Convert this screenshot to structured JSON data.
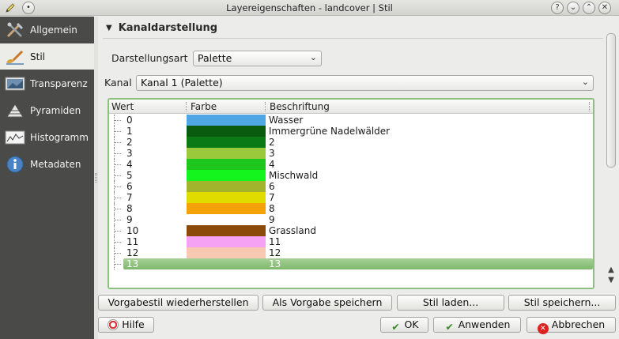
{
  "window": {
    "title": "Layereigenschaften - landcover | Stil",
    "title_icons": [
      "pencil-icon",
      "menu-icon"
    ],
    "controls": {
      "help": "?",
      "minimize": "⌄",
      "maximize": "⌃",
      "close": "✕"
    }
  },
  "sidebar": {
    "items": [
      {
        "label": "Allgemein",
        "icon": "tools-icon",
        "active": false
      },
      {
        "label": "Stil",
        "icon": "brush-icon",
        "active": true
      },
      {
        "label": "Transparenz",
        "icon": "transparency-icon",
        "active": false
      },
      {
        "label": "Pyramiden",
        "icon": "pyramid-icon",
        "active": false
      },
      {
        "label": "Histogramm",
        "icon": "histogram-icon",
        "active": false
      },
      {
        "label": "Metadaten",
        "icon": "info-icon",
        "active": false
      }
    ]
  },
  "section": {
    "title": "Kanaldarstellung",
    "arrow": "▼"
  },
  "render_type": {
    "label": "Darstellungsart",
    "value": "Palette"
  },
  "band": {
    "label": "Kanal",
    "value": "Kanal 1 (Palette)"
  },
  "table": {
    "headers": {
      "wert": "Wert",
      "farbe": "Farbe",
      "beschriftung": "Beschriftung"
    },
    "rows": [
      {
        "wert": "0",
        "color": "#4fa6e2",
        "label": "Wasser"
      },
      {
        "wert": "1",
        "color": "#0a5a10",
        "label": "Immergrüne Nadelwälder"
      },
      {
        "wert": "2",
        "color": "#0b7a16",
        "label": "2"
      },
      {
        "wert": "3",
        "color": "#9ac93c",
        "label": "3"
      },
      {
        "wert": "4",
        "color": "#1ec71e",
        "label": "4"
      },
      {
        "wert": "5",
        "color": "#14f51e",
        "label": "Mischwald"
      },
      {
        "wert": "6",
        "color": "#a2b42c",
        "label": "6"
      },
      {
        "wert": "7",
        "color": "#e0dc00",
        "label": "7"
      },
      {
        "wert": "8",
        "color": "#f5a10a",
        "label": "8"
      },
      {
        "wert": "9",
        "color": "#ffffff",
        "label": "9"
      },
      {
        "wert": "10",
        "color": "#8c4a0a",
        "label": "Grassland"
      },
      {
        "wert": "11",
        "color": "#f5a2f5",
        "label": "11"
      },
      {
        "wert": "12",
        "color": "#f8c9b0",
        "label": "12"
      },
      {
        "wert": "13",
        "color": "#8fc47e",
        "label": "13",
        "selected": true
      }
    ]
  },
  "buttons_row1": {
    "restore_default": "Vorgabestil wiederherstellen",
    "save_default": "Als Vorgabe speichern",
    "load_style": "Stil laden...",
    "save_style": "Stil speichern..."
  },
  "buttons_row2": {
    "help": "Hilfe",
    "ok": "OK",
    "apply": "Anwenden",
    "cancel": "Abbrechen"
  },
  "scrollbar": {
    "up": "▲",
    "down": "▼"
  }
}
